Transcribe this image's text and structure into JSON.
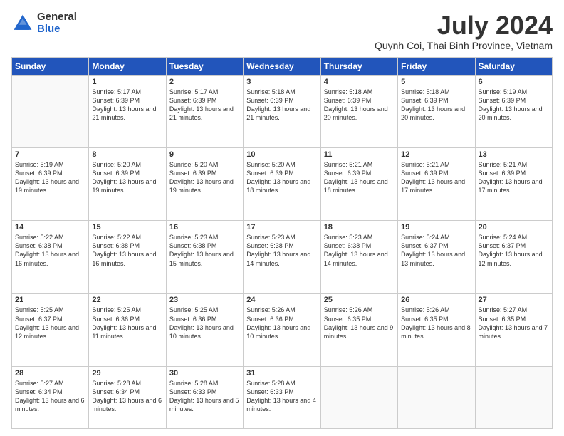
{
  "logo": {
    "general": "General",
    "blue": "Blue"
  },
  "header": {
    "month": "July 2024",
    "location": "Quynh Coi, Thai Binh Province, Vietnam"
  },
  "weekdays": [
    "Sunday",
    "Monday",
    "Tuesday",
    "Wednesday",
    "Thursday",
    "Friday",
    "Saturday"
  ],
  "weeks": [
    [
      {
        "day": "",
        "info": ""
      },
      {
        "day": "1",
        "info": "Sunrise: 5:17 AM\nSunset: 6:39 PM\nDaylight: 13 hours\nand 21 minutes."
      },
      {
        "day": "2",
        "info": "Sunrise: 5:17 AM\nSunset: 6:39 PM\nDaylight: 13 hours\nand 21 minutes."
      },
      {
        "day": "3",
        "info": "Sunrise: 5:18 AM\nSunset: 6:39 PM\nDaylight: 13 hours\nand 21 minutes."
      },
      {
        "day": "4",
        "info": "Sunrise: 5:18 AM\nSunset: 6:39 PM\nDaylight: 13 hours\nand 20 minutes."
      },
      {
        "day": "5",
        "info": "Sunrise: 5:18 AM\nSunset: 6:39 PM\nDaylight: 13 hours\nand 20 minutes."
      },
      {
        "day": "6",
        "info": "Sunrise: 5:19 AM\nSunset: 6:39 PM\nDaylight: 13 hours\nand 20 minutes."
      }
    ],
    [
      {
        "day": "7",
        "info": "Sunrise: 5:19 AM\nSunset: 6:39 PM\nDaylight: 13 hours\nand 19 minutes."
      },
      {
        "day": "8",
        "info": "Sunrise: 5:20 AM\nSunset: 6:39 PM\nDaylight: 13 hours\nand 19 minutes."
      },
      {
        "day": "9",
        "info": "Sunrise: 5:20 AM\nSunset: 6:39 PM\nDaylight: 13 hours\nand 19 minutes."
      },
      {
        "day": "10",
        "info": "Sunrise: 5:20 AM\nSunset: 6:39 PM\nDaylight: 13 hours\nand 18 minutes."
      },
      {
        "day": "11",
        "info": "Sunrise: 5:21 AM\nSunset: 6:39 PM\nDaylight: 13 hours\nand 18 minutes."
      },
      {
        "day": "12",
        "info": "Sunrise: 5:21 AM\nSunset: 6:39 PM\nDaylight: 13 hours\nand 17 minutes."
      },
      {
        "day": "13",
        "info": "Sunrise: 5:21 AM\nSunset: 6:39 PM\nDaylight: 13 hours\nand 17 minutes."
      }
    ],
    [
      {
        "day": "14",
        "info": "Sunrise: 5:22 AM\nSunset: 6:38 PM\nDaylight: 13 hours\nand 16 minutes."
      },
      {
        "day": "15",
        "info": "Sunrise: 5:22 AM\nSunset: 6:38 PM\nDaylight: 13 hours\nand 16 minutes."
      },
      {
        "day": "16",
        "info": "Sunrise: 5:23 AM\nSunset: 6:38 PM\nDaylight: 13 hours\nand 15 minutes."
      },
      {
        "day": "17",
        "info": "Sunrise: 5:23 AM\nSunset: 6:38 PM\nDaylight: 13 hours\nand 14 minutes."
      },
      {
        "day": "18",
        "info": "Sunrise: 5:23 AM\nSunset: 6:38 PM\nDaylight: 13 hours\nand 14 minutes."
      },
      {
        "day": "19",
        "info": "Sunrise: 5:24 AM\nSunset: 6:37 PM\nDaylight: 13 hours\nand 13 minutes."
      },
      {
        "day": "20",
        "info": "Sunrise: 5:24 AM\nSunset: 6:37 PM\nDaylight: 13 hours\nand 12 minutes."
      }
    ],
    [
      {
        "day": "21",
        "info": "Sunrise: 5:25 AM\nSunset: 6:37 PM\nDaylight: 13 hours\nand 12 minutes."
      },
      {
        "day": "22",
        "info": "Sunrise: 5:25 AM\nSunset: 6:36 PM\nDaylight: 13 hours\nand 11 minutes."
      },
      {
        "day": "23",
        "info": "Sunrise: 5:25 AM\nSunset: 6:36 PM\nDaylight: 13 hours\nand 10 minutes."
      },
      {
        "day": "24",
        "info": "Sunrise: 5:26 AM\nSunset: 6:36 PM\nDaylight: 13 hours\nand 10 minutes."
      },
      {
        "day": "25",
        "info": "Sunrise: 5:26 AM\nSunset: 6:35 PM\nDaylight: 13 hours\nand 9 minutes."
      },
      {
        "day": "26",
        "info": "Sunrise: 5:26 AM\nSunset: 6:35 PM\nDaylight: 13 hours\nand 8 minutes."
      },
      {
        "day": "27",
        "info": "Sunrise: 5:27 AM\nSunset: 6:35 PM\nDaylight: 13 hours\nand 7 minutes."
      }
    ],
    [
      {
        "day": "28",
        "info": "Sunrise: 5:27 AM\nSunset: 6:34 PM\nDaylight: 13 hours\nand 6 minutes."
      },
      {
        "day": "29",
        "info": "Sunrise: 5:28 AM\nSunset: 6:34 PM\nDaylight: 13 hours\nand 6 minutes."
      },
      {
        "day": "30",
        "info": "Sunrise: 5:28 AM\nSunset: 6:33 PM\nDaylight: 13 hours\nand 5 minutes."
      },
      {
        "day": "31",
        "info": "Sunrise: 5:28 AM\nSunset: 6:33 PM\nDaylight: 13 hours\nand 4 minutes."
      },
      {
        "day": "",
        "info": ""
      },
      {
        "day": "",
        "info": ""
      },
      {
        "day": "",
        "info": ""
      }
    ]
  ]
}
